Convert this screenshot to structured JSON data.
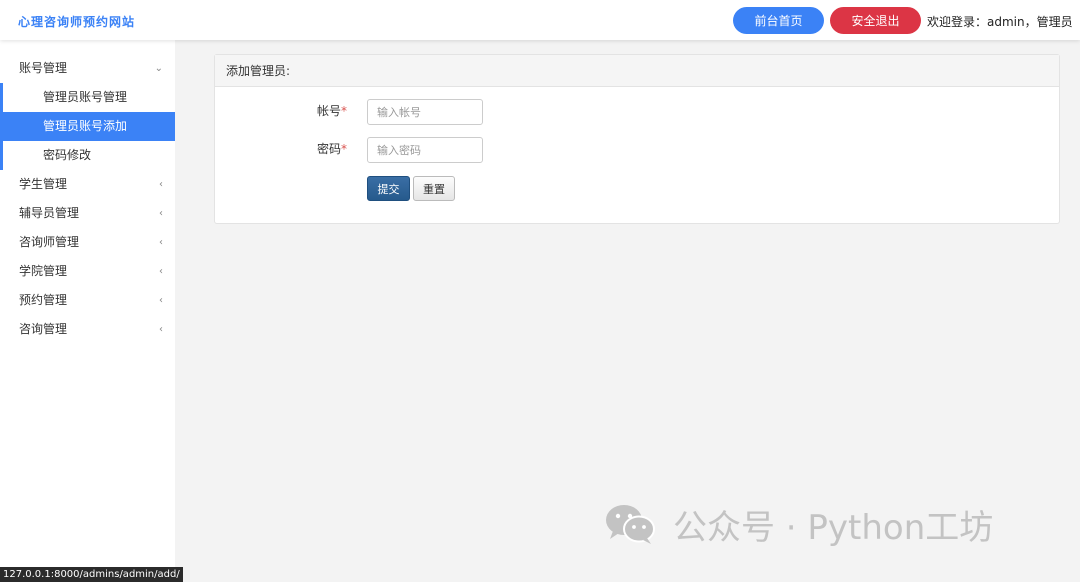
{
  "header": {
    "brand": "心理咨询师预约网站",
    "home_button": "前台首页",
    "logout_button": "安全退出",
    "welcome": "欢迎登录：admin，管理员"
  },
  "sidebar": {
    "groups": [
      {
        "label": "账号管理",
        "arrow": "⌄",
        "expanded": true,
        "items": [
          {
            "label": "管理员账号管理"
          },
          {
            "label": "管理员账号添加",
            "active": true
          },
          {
            "label": "密码修改"
          }
        ]
      },
      {
        "label": "学生管理",
        "arrow": "‹"
      },
      {
        "label": "辅导员管理",
        "arrow": "‹"
      },
      {
        "label": "咨询师管理",
        "arrow": "‹"
      },
      {
        "label": "学院管理",
        "arrow": "‹"
      },
      {
        "label": "预约管理",
        "arrow": "‹"
      },
      {
        "label": "咨询管理",
        "arrow": "‹"
      }
    ]
  },
  "panel": {
    "title": "添加管理员:",
    "fields": [
      {
        "label": "帐号",
        "required_mark": "*",
        "placeholder": "输入帐号",
        "value": ""
      },
      {
        "label": "密码",
        "required_mark": "*",
        "placeholder": "输入密码",
        "value": ""
      }
    ],
    "submit_label": "提交",
    "reset_label": "重置"
  },
  "statusbar": {
    "url": "127.0.0.1:8000/admins/admin/add/"
  },
  "watermark": {
    "text": "公众号 · Python工坊",
    "icon": "wechat-icon"
  },
  "colors": {
    "accent": "#3b82f6",
    "danger": "#dc3545",
    "submit": "#2d6399"
  }
}
